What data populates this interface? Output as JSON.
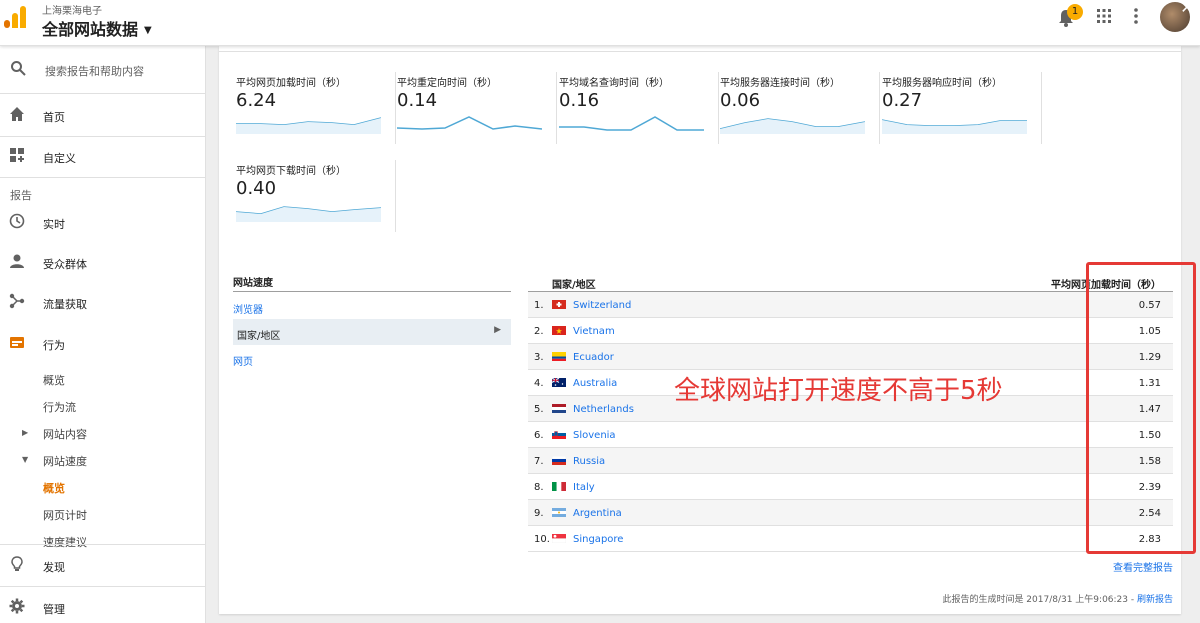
{
  "header": {
    "org": "上海栗海电子",
    "property": "全部网站数据",
    "notification_count": "1"
  },
  "sidebar": {
    "search_placeholder": "搜索报告和帮助内容",
    "home": "首页",
    "customize": "自定义",
    "reports_label": "报告",
    "realtime": "实时",
    "audience": "受众群体",
    "acquisition": "流量获取",
    "behavior": "行为",
    "behavior_sub": {
      "overview": "概览",
      "flow": "行为流",
      "content": "网站内容",
      "speed": "网站速度",
      "speed_overview": "概览",
      "page_timings": "网页计时",
      "suggestions": "速度建议"
    },
    "discover": "发现",
    "admin": "管理"
  },
  "metrics": [
    {
      "label": "平均网页加载时间（秒）",
      "value": "6.24"
    },
    {
      "label": "平均重定向时间（秒）",
      "value": "0.14"
    },
    {
      "label": "平均域名查询时间（秒）",
      "value": "0.16"
    },
    {
      "label": "平均服务器连接时间（秒）",
      "value": "0.06"
    },
    {
      "label": "平均服务器响应时间（秒）",
      "value": "0.27"
    },
    {
      "label": "平均网页下载时间（秒）",
      "value": "0.40"
    }
  ],
  "left_table": {
    "header": "网站速度",
    "rows": [
      "浏览器",
      "国家/地区",
      "网页"
    ]
  },
  "right_table": {
    "col1": "国家/地区",
    "col2": "平均网页加载时间（秒）",
    "rows": [
      {
        "rank": "1.",
        "country": "Switzerland",
        "value": "0.57"
      },
      {
        "rank": "2.",
        "country": "Vietnam",
        "value": "1.05"
      },
      {
        "rank": "3.",
        "country": "Ecuador",
        "value": "1.29"
      },
      {
        "rank": "4.",
        "country": "Australia",
        "value": "1.31"
      },
      {
        "rank": "5.",
        "country": "Netherlands",
        "value": "1.47"
      },
      {
        "rank": "6.",
        "country": "Slovenia",
        "value": "1.50"
      },
      {
        "rank": "7.",
        "country": "Russia",
        "value": "1.58"
      },
      {
        "rank": "8.",
        "country": "Italy",
        "value": "2.39"
      },
      {
        "rank": "9.",
        "country": "Argentina",
        "value": "2.54"
      },
      {
        "rank": "10.",
        "country": "Singapore",
        "value": "2.83"
      }
    ]
  },
  "footer": {
    "full_report": "查看完整报告",
    "generated": "此报告的生成时间是 2017/8/31 上午9:06:23 - ",
    "refresh": "刷新报告"
  },
  "annotation": "全球网站打开速度不高于5秒",
  "colors": {
    "accent": "#e37400",
    "link": "#1a73e8",
    "annotation": "#e53935",
    "sparkline": "#4fa8d5"
  }
}
